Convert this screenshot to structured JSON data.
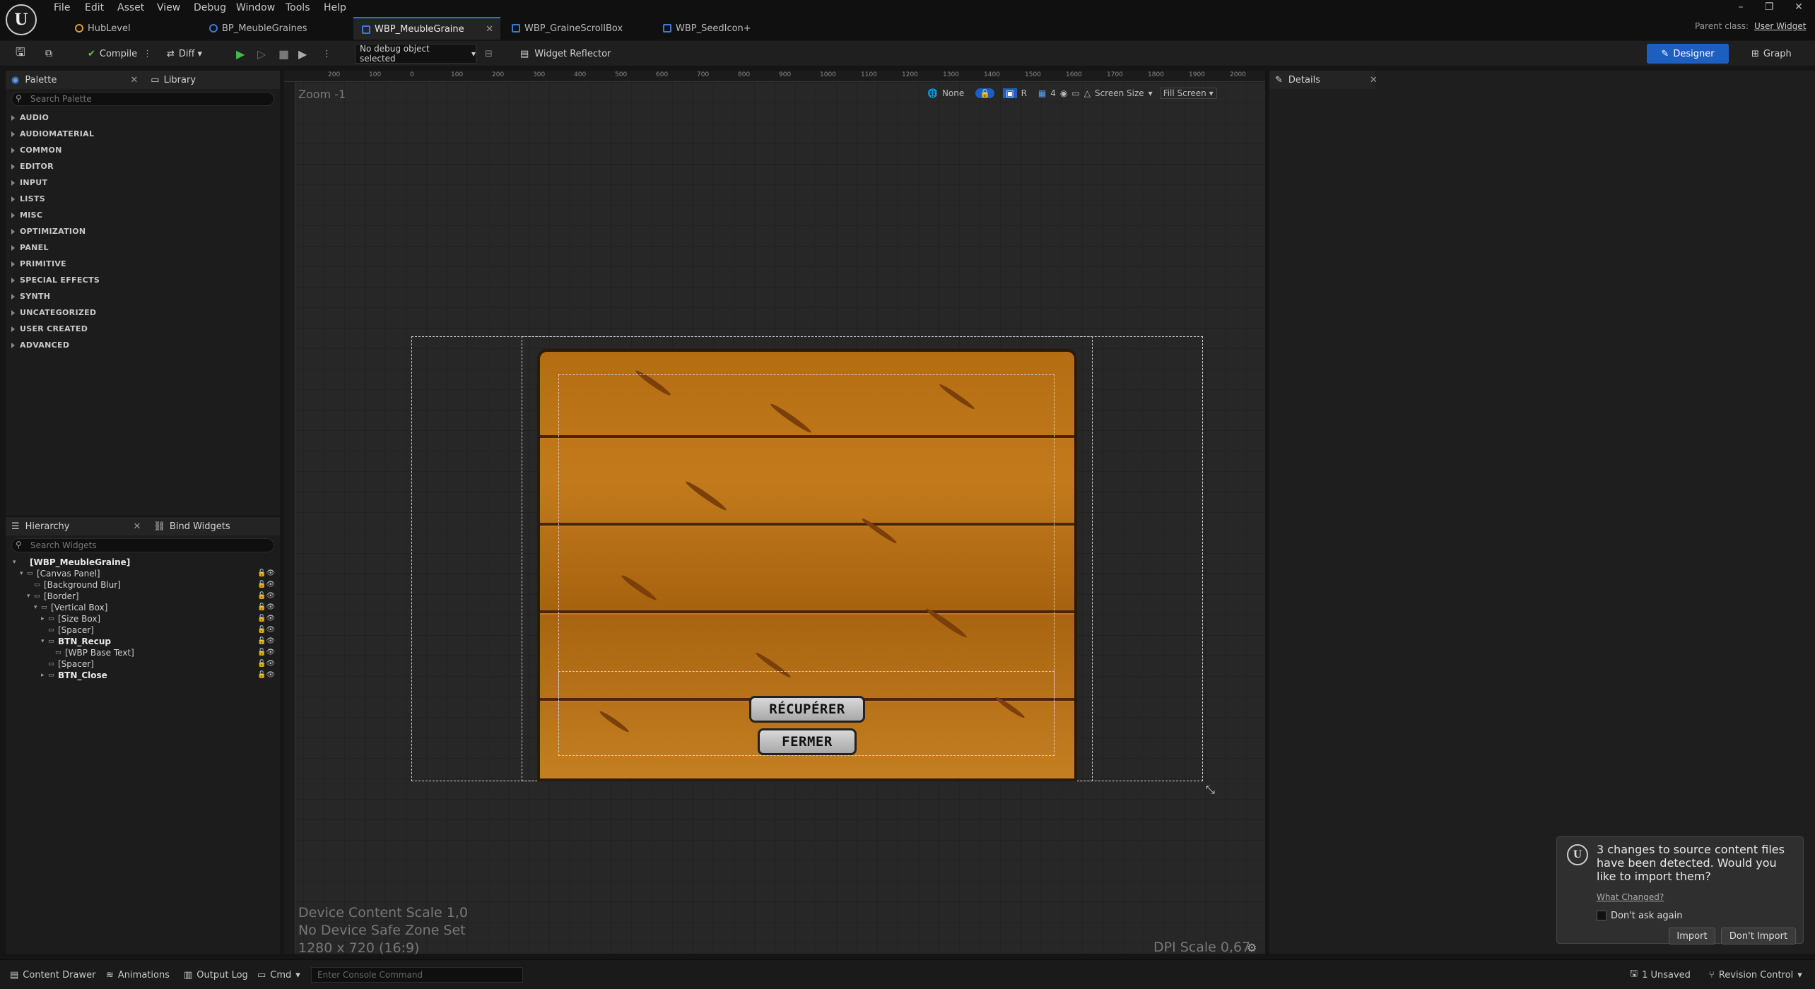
{
  "menu": [
    "File",
    "Edit",
    "Asset",
    "View",
    "Debug",
    "Window",
    "Tools",
    "Help"
  ],
  "tabs": [
    {
      "label": "HubLevel",
      "color": "#e0a020"
    },
    {
      "label": "BP_MeubleGraines",
      "color": "#3a7bd5"
    },
    {
      "label": "WBP_MeubleGraine",
      "color": "#3a7bd5",
      "active": true
    },
    {
      "label": "WBP_GraineScrollBox",
      "color": "#3a7bd5"
    },
    {
      "label": "WBP_SeedIcon+",
      "color": "#3a7bd5"
    }
  ],
  "parent_class": {
    "label": "Parent class:",
    "value": "User Widget"
  },
  "toolbar": {
    "compile": "Compile",
    "diff": "Diff",
    "debug_select": "No debug object selected",
    "widget_reflector": "Widget Reflector",
    "designer": "Designer",
    "graph": "Graph"
  },
  "palette": {
    "tab": "Palette",
    "library_tab": "Library",
    "search_placeholder": "Search Palette",
    "categories": [
      "AUDIO",
      "AUDIOMATERIAL",
      "COMMON",
      "EDITOR",
      "INPUT",
      "LISTS",
      "MISC",
      "OPTIMIZATION",
      "PANEL",
      "PRIMITIVE",
      "SPECIAL EFFECTS",
      "SYNTH",
      "UNCATEGORIZED",
      "USER CREATED",
      "ADVANCED"
    ]
  },
  "hierarchy": {
    "tab": "Hierarchy",
    "bind_tab": "Bind Widgets",
    "search_placeholder": "Search Widgets",
    "items": [
      {
        "label": "[WBP_MeubleGraine]",
        "indent": 0,
        "bold": true
      },
      {
        "label": "[Canvas Panel]",
        "indent": 1
      },
      {
        "label": "[Background Blur]",
        "indent": 2
      },
      {
        "label": "[Border]",
        "indent": 2
      },
      {
        "label": "[Vertical Box]",
        "indent": 3
      },
      {
        "label": "[Size Box]",
        "indent": 4
      },
      {
        "label": "[Spacer]",
        "indent": 4
      },
      {
        "label": "BTN_Recup",
        "indent": 4,
        "bold": true
      },
      {
        "label": "[WBP Base Text]",
        "indent": 5
      },
      {
        "label": "[Spacer]",
        "indent": 4
      },
      {
        "label": "BTN_Close",
        "indent": 4,
        "bold": true
      }
    ]
  },
  "designer": {
    "zoom": "Zoom -1",
    "none": "None",
    "r": "R",
    "grid_snap": "4",
    "screen_size": "Screen Size",
    "fill_screen": "Fill Screen",
    "ruler": [
      "200",
      "100",
      "0",
      "100",
      "200",
      "300",
      "400",
      "500",
      "600",
      "700",
      "800",
      "900",
      "1000",
      "1100",
      "1200",
      "1300",
      "1400",
      "1500",
      "1600",
      "1700",
      "1800",
      "1900",
      "2000"
    ],
    "btn_recup": "RÉCUPÉRER",
    "btn_close": "FERMER",
    "info1": "Device Content Scale 1,0",
    "info2": "No Device Safe Zone Set",
    "info3": "1280 x 720 (16:9)",
    "dpi": "DPI Scale 0,67"
  },
  "details": {
    "tab": "Details"
  },
  "toast": {
    "message": "3 changes to source content files have been detected. Would you like to import them?",
    "link": "What Changed?",
    "checkbox": "Don't ask again",
    "import": "Import",
    "dont_import": "Don't Import"
  },
  "status": {
    "content_drawer": "Content Drawer",
    "animations": "Animations",
    "output_log": "Output Log",
    "cmd": "Cmd",
    "console_placeholder": "Enter Console Command",
    "unsaved": "1 Unsaved",
    "revision": "Revision Control"
  }
}
